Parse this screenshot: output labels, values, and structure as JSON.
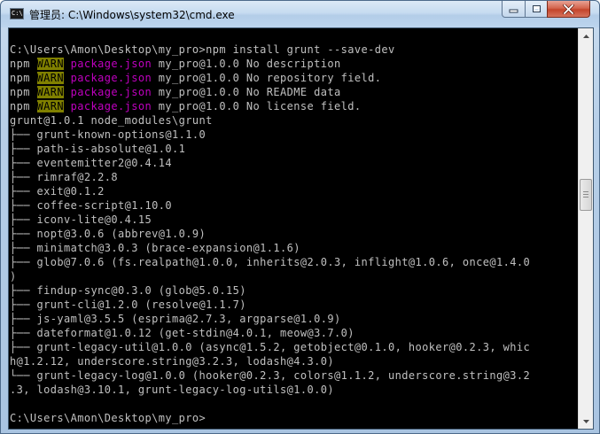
{
  "window": {
    "title": "管理员: C:\\Windows\\system32\\cmd.exe",
    "icon": "cmd-icon",
    "icon_text": "C:\\"
  },
  "controls": {
    "minimize_icon": "minimize-icon",
    "maximize_icon": "maximize-icon",
    "close_icon": "close-icon"
  },
  "console": {
    "lines": [
      [
        {
          "t": ""
        }
      ],
      [
        {
          "t": "C:\\Users\\Amon\\Desktop\\my_pro>npm install grunt --save-dev"
        }
      ],
      [
        {
          "t": "npm "
        },
        {
          "t": "WARN",
          "s": "warn"
        },
        {
          "t": " "
        },
        {
          "t": "package.json",
          "s": "pkg"
        },
        {
          "t": " my_pro@1.0.0 No description"
        }
      ],
      [
        {
          "t": "npm "
        },
        {
          "t": "WARN",
          "s": "warn"
        },
        {
          "t": " "
        },
        {
          "t": "package.json",
          "s": "pkg"
        },
        {
          "t": " my_pro@1.0.0 No repository field."
        }
      ],
      [
        {
          "t": "npm "
        },
        {
          "t": "WARN",
          "s": "warn"
        },
        {
          "t": " "
        },
        {
          "t": "package.json",
          "s": "pkg"
        },
        {
          "t": " my_pro@1.0.0 No README data"
        }
      ],
      [
        {
          "t": "npm "
        },
        {
          "t": "WARN",
          "s": "warn"
        },
        {
          "t": " "
        },
        {
          "t": "package.json",
          "s": "pkg"
        },
        {
          "t": " my_pro@1.0.0 No license field."
        }
      ],
      [
        {
          "t": "grunt@1.0.1 node_modules\\grunt"
        }
      ],
      [
        {
          "t": "├── grunt-known-options@1.1.0"
        }
      ],
      [
        {
          "t": "├── path-is-absolute@1.0.1"
        }
      ],
      [
        {
          "t": "├── eventemitter2@0.4.14"
        }
      ],
      [
        {
          "t": "├── rimraf@2.2.8"
        }
      ],
      [
        {
          "t": "├── exit@0.1.2"
        }
      ],
      [
        {
          "t": "├── coffee-script@1.10.0"
        }
      ],
      [
        {
          "t": "├── iconv-lite@0.4.15"
        }
      ],
      [
        {
          "t": "├── nopt@3.0.6 (abbrev@1.0.9)"
        }
      ],
      [
        {
          "t": "├── minimatch@3.0.3 (brace-expansion@1.1.6)"
        }
      ],
      [
        {
          "t": "├── glob@7.0.6 (fs.realpath@1.0.0, inherits@2.0.3, inflight@1.0.6, once@1.4.0"
        }
      ],
      [
        {
          "t": ")"
        }
      ],
      [
        {
          "t": "├── findup-sync@0.3.0 (glob@5.0.15)"
        }
      ],
      [
        {
          "t": "├── grunt-cli@1.2.0 (resolve@1.1.7)"
        }
      ],
      [
        {
          "t": "├── js-yaml@3.5.5 (esprima@2.7.3, argparse@1.0.9)"
        }
      ],
      [
        {
          "t": "├── dateformat@1.0.12 (get-stdin@4.0.1, meow@3.7.0)"
        }
      ],
      [
        {
          "t": "├── grunt-legacy-util@1.0.0 (async@1.5.2, getobject@0.1.0, hooker@0.2.3, whic"
        }
      ],
      [
        {
          "t": "h@1.2.12, underscore.string@3.2.3, lodash@4.3.0)"
        }
      ],
      [
        {
          "t": "└── grunt-legacy-log@1.0.0 (hooker@0.2.3, colors@1.1.2, underscore.string@3.2"
        }
      ],
      [
        {
          "t": ".3, lodash@3.10.1, grunt-legacy-log-utils@1.0.0)"
        }
      ],
      [
        {
          "t": ""
        }
      ],
      [
        {
          "t": "C:\\Users\\Amon\\Desktop\\my_pro>"
        }
      ]
    ]
  },
  "scrollbar": {
    "up_icon": "scroll-up-arrow-icon",
    "down_icon": "scroll-down-arrow-icon",
    "position": 0.4
  },
  "colors": {
    "console_bg": "#000000",
    "console_fg": "#c0c0c0",
    "warn_bg": "#808000",
    "package_fg": "#c000c0"
  }
}
